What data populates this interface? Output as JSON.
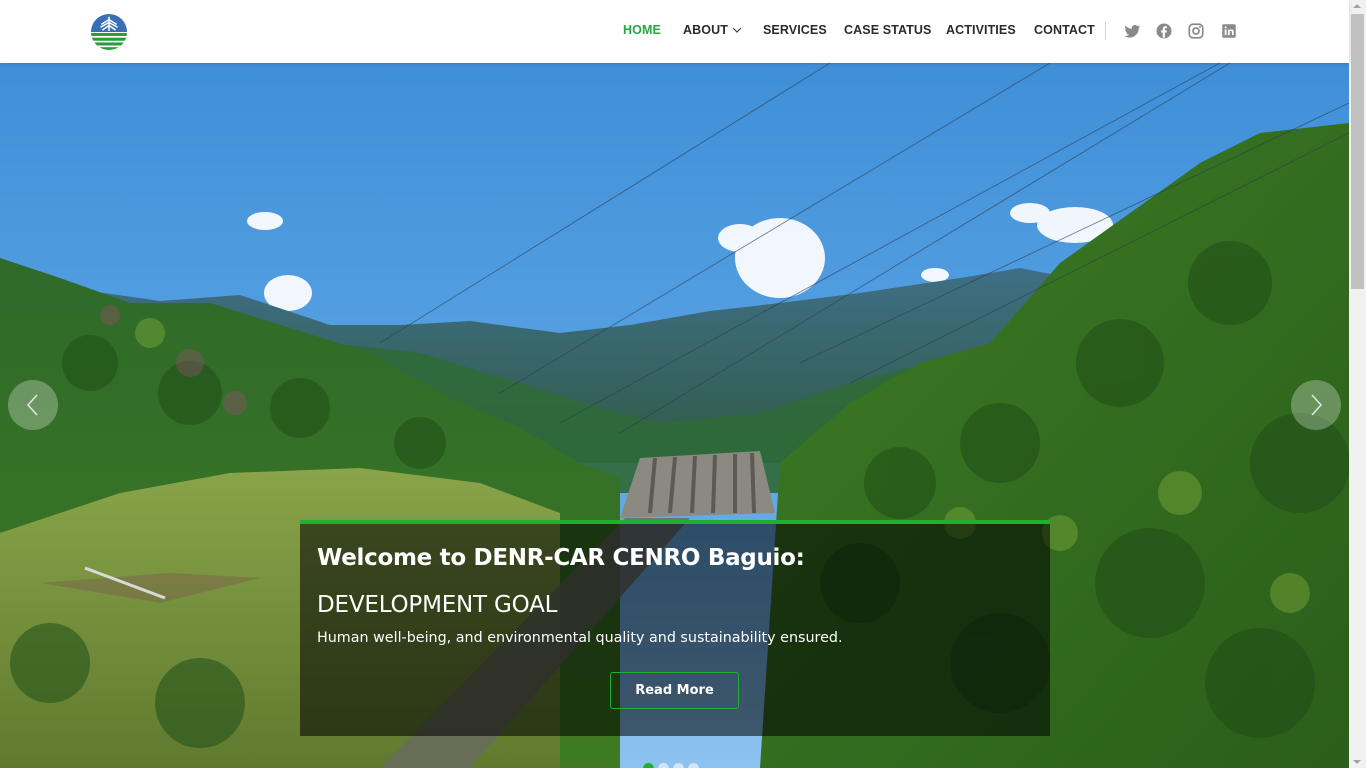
{
  "header": {
    "logo_icon": "denr-logo-icon",
    "nav": [
      {
        "label": "HOME",
        "active": true
      },
      {
        "label": "ABOUT",
        "has_dropdown": true
      },
      {
        "label": "SERVICES"
      },
      {
        "label": "CASE STATUS"
      },
      {
        "label": "ACTIVITIES"
      },
      {
        "label": "CONTACT"
      }
    ],
    "social_icons": [
      "twitter-icon",
      "facebook-icon",
      "instagram-icon",
      "linkedin-icon"
    ]
  },
  "hero": {
    "welcome": "Welcome to DENR-CAR CENRO Baguio:",
    "heading": "DEVELOPMENT GOAL",
    "description": "Human well-being, and environmental quality and sustainability ensured.",
    "button_label": "Read More",
    "slide_count": 4,
    "active_slide": 1
  },
  "colors": {
    "accent": "#1fb02f",
    "nav_active": "#28a745",
    "nav_text": "#2b2b2b",
    "social_icon": "#8a8a8a"
  }
}
